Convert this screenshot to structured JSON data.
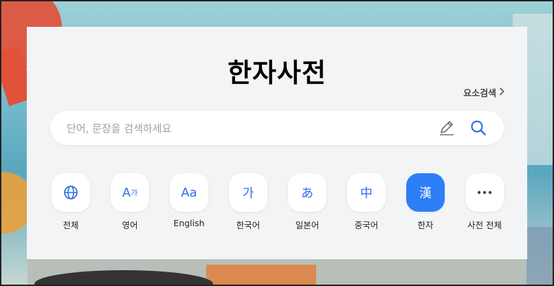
{
  "title": "한자사전",
  "element_search": {
    "label": "요소검색"
  },
  "search": {
    "placeholder": "단어, 문장을 검색하세요"
  },
  "categories": [
    {
      "label": "전체",
      "icon": "globe-icon"
    },
    {
      "label": "영어",
      "icon": "a-ga-icon",
      "glyph_main": "A",
      "glyph_sub": "가"
    },
    {
      "label": "English",
      "icon": "aa-icon",
      "glyph_main": "Aa"
    },
    {
      "label": "한국어",
      "icon": "hangul-ga-icon",
      "glyph_main": "가"
    },
    {
      "label": "일본어",
      "icon": "hiragana-a-icon",
      "glyph_main": "あ"
    },
    {
      "label": "중국어",
      "icon": "chinese-zhong-icon",
      "glyph_main": "中"
    },
    {
      "label": "한자",
      "icon": "hanja-icon",
      "glyph_main": "漢",
      "active": true
    },
    {
      "label": "사전 전체",
      "icon": "more-icon"
    }
  ],
  "colors": {
    "accent": "#2d7ef7",
    "icon_blue": "#2f6fe4",
    "panel_bg": "#f3f4f6"
  }
}
